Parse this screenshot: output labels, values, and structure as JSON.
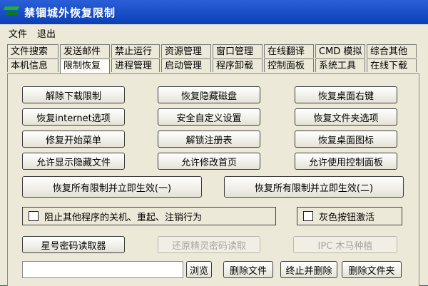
{
  "window": {
    "title": "禁锢城外恢复限制"
  },
  "menu": [
    "文件",
    "退出"
  ],
  "tabs": {
    "row1": [
      "文件搜索",
      "发送邮件",
      "禁止运行",
      "资源管理",
      "窗口管理",
      "在线翻译",
      "CMD 模拟",
      "综合其他"
    ],
    "row2": [
      "本机信息",
      "限制恢复",
      "进程管理",
      "启动管理",
      "程序卸载",
      "控制面板",
      "系统工具",
      "在线下载"
    ],
    "active": "限制恢复"
  },
  "buttons": {
    "unlock_download": "解除下载限制",
    "restore_hidden_disk": "恢复隐藏磁盘",
    "restore_desktop_rightclick": "恢复桌面右键",
    "restore_internet_options": "恢复internet选项",
    "safe_custom_settings": "安全自定义设置",
    "restore_folder_options": "恢复文件夹选项",
    "repair_start_menu": "修复开始菜单",
    "unlock_registry": "解锁注册表",
    "restore_desktop_icons": "恢复桌面图标",
    "allow_show_hidden_files": "允许显示隐藏文件",
    "allow_modify_homepage": "允许修改首页",
    "allow_control_panel": "允许使用控制面板",
    "restore_all_1": "恢复所有限制并立即生效(一)",
    "restore_all_2": "恢复所有限制并立即生效(二)",
    "star_password_reader": "星号密码读取器",
    "restore_wizard_password": "还原精灵密码读取",
    "ipc_trojan": "IPC 木马种植",
    "browse": "浏览",
    "delete_file": "删除文件",
    "terminate_delete": "终止并删除",
    "delete_folder": "删除文件夹"
  },
  "checkboxes": {
    "block_shutdown": {
      "label": "阻止其他程序的关机、重起、注销行为",
      "checked": false
    },
    "gray_button_activate": {
      "label": "灰色按钮激活",
      "checked": false
    }
  },
  "path_input": {
    "value": ""
  }
}
